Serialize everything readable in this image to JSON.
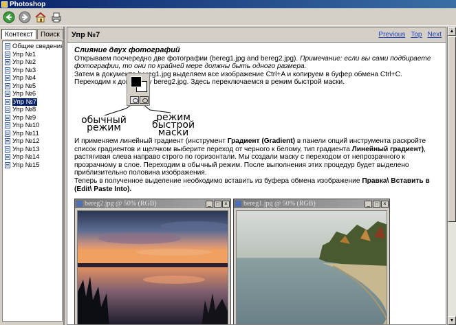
{
  "window": {
    "title": "Photoshop"
  },
  "toolbar": {
    "buttons": [
      "back-icon",
      "forward-icon",
      "home-icon",
      "print-icon"
    ]
  },
  "sidebar": {
    "tabs": [
      {
        "label": "Контекст",
        "active": true
      },
      {
        "label": "Поиск",
        "active": false
      }
    ],
    "items": [
      {
        "label": "Общие сведения"
      },
      {
        "label": "Упр №1"
      },
      {
        "label": "Упр №2"
      },
      {
        "label": "Упр №3"
      },
      {
        "label": "Упр №4"
      },
      {
        "label": "Упр №5"
      },
      {
        "label": "Упр №6"
      },
      {
        "label": "Упр №7",
        "selected": true
      },
      {
        "label": "Упр №8"
      },
      {
        "label": "Упр №9"
      },
      {
        "label": "Упр №10"
      },
      {
        "label": "Упр №11"
      },
      {
        "label": "Упр №12"
      },
      {
        "label": "Упр №13"
      },
      {
        "label": "Упр №14"
      },
      {
        "label": "Упр №15"
      }
    ]
  },
  "content": {
    "header_title": "Упр №7",
    "nav": {
      "previous": "Previous",
      "top": "Top",
      "next": "Next"
    },
    "section_title": "Слияние двух фотографий",
    "p1_a": "Открываем поочередно две фотографии (bereg1.jpg and bereg2.jpg). ",
    "p1_note_em": "Примечание: если вы сами подбираете фотографии, то они по крайней мере должны быть одного размера.",
    "p2": "Затем в документе bereg1.jpg выделяем все изображение Ctrl+A и копируем в буфер обмена Ctrl+C.",
    "p3": "Переходим к документу bereg2.jpg. Здесь переключаемся в режим быстрой маски.",
    "figure_labels": {
      "normal_mode": "обычный режим",
      "quick_mask": "режим быстрой маски"
    },
    "p4_a": "И применяем линейный градиент (инструмент ",
    "p4_b_bold": "Градиент (Gradient)",
    "p4_c": " в панели опций инструмента раскройте список градиентов и щелчком выберите переход от черного к белому, тип градиента ",
    "p4_d_bold": "Линейный градиент)",
    "p4_e": ", растягивая слева направо строго по горизонтали. Мы создали маску с переходом от непрозрачного к прозрачному в слое. Переходим в обычный режим. После выполнения этих процедур будет выделено приблизительно половина изображения.",
    "p5_a": "Теперь в полученное выделение необходимо вставить из буфера обмена изображение ",
    "p5_b_bold": "Правка\\ Вставить в (Edit\\ Paste Into).",
    "windows": [
      {
        "title": "bereg2.jpg @ 50% (RGB)"
      },
      {
        "title": "bereg1.jpg @ 50% (RGB)"
      }
    ]
  },
  "colors": {
    "selection": "#0a246a",
    "link": "#1f3fbf",
    "chrome": "#d4d0c8"
  }
}
